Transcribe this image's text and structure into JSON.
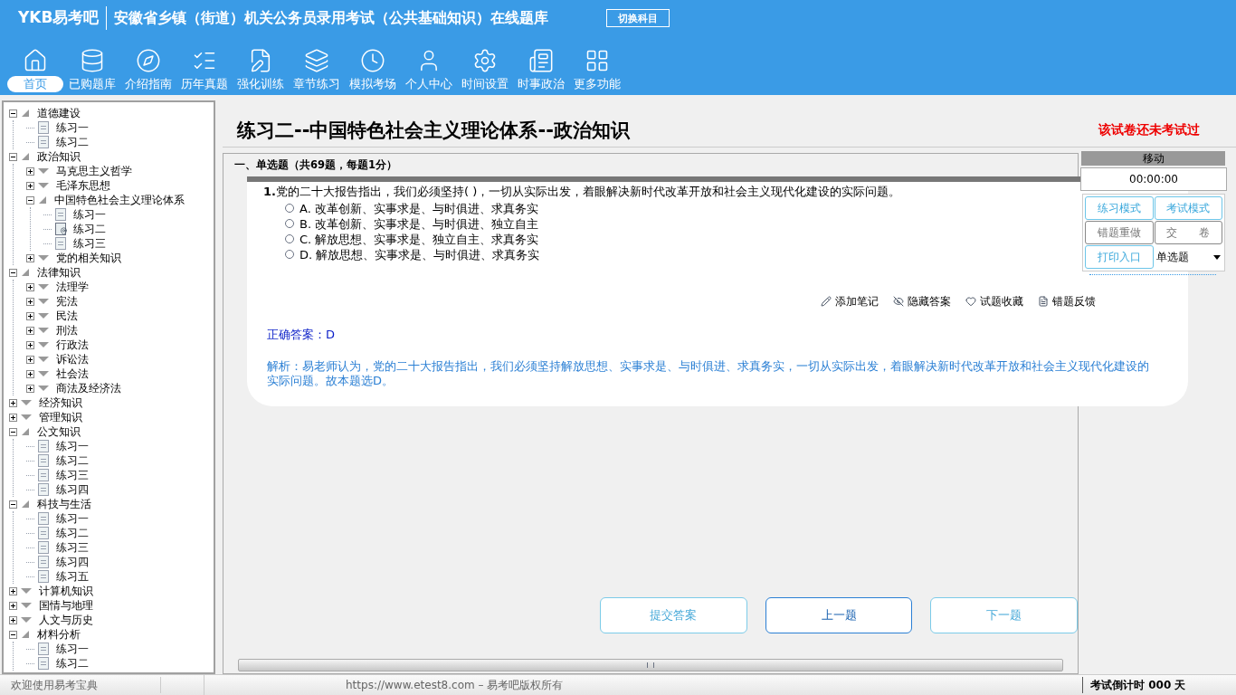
{
  "header": {
    "logo": "YKB易考吧",
    "title": "安徽省乡镇（街道）机关公务员录用考试（公共基础知识）在线题库",
    "switch_button": "切换科目"
  },
  "toolbar": [
    {
      "label": "首页",
      "selected": true
    },
    {
      "label": "已购题库",
      "selected": false
    },
    {
      "label": "介绍指南",
      "selected": false
    },
    {
      "label": "历年真题",
      "selected": false
    },
    {
      "label": "强化训练",
      "selected": false
    },
    {
      "label": "章节练习",
      "selected": false
    },
    {
      "label": "模拟考场",
      "selected": false
    },
    {
      "label": "个人中心",
      "selected": false
    },
    {
      "label": "时间设置",
      "selected": false
    },
    {
      "label": "时事政治",
      "selected": false
    },
    {
      "label": "更多功能",
      "selected": false
    }
  ],
  "tree": [
    {
      "label": "道德建设",
      "kind": "folder",
      "expanded": true,
      "children": [
        {
          "label": "练习一",
          "kind": "file",
          "selected": false
        },
        {
          "label": "练习二",
          "kind": "file",
          "selected": false
        }
      ]
    },
    {
      "label": "政治知识",
      "kind": "folder",
      "expanded": true,
      "children": [
        {
          "label": "马克思主义哲学",
          "kind": "folder",
          "expanded": false
        },
        {
          "label": "毛泽东思想",
          "kind": "folder",
          "expanded": false
        },
        {
          "label": "中国特色社会主义理论体系",
          "kind": "folder",
          "expanded": true,
          "children": [
            {
              "label": "练习一",
              "kind": "file",
              "selected": false
            },
            {
              "label": "练习二",
              "kind": "file",
              "selected": true
            },
            {
              "label": "练习三",
              "kind": "file",
              "selected": false
            }
          ]
        },
        {
          "label": "党的相关知识",
          "kind": "folder",
          "expanded": false
        }
      ]
    },
    {
      "label": "法律知识",
      "kind": "folder",
      "expanded": true,
      "children": [
        {
          "label": "法理学",
          "kind": "folder",
          "expanded": false
        },
        {
          "label": "宪法",
          "kind": "folder",
          "expanded": false
        },
        {
          "label": "民法",
          "kind": "folder",
          "expanded": false
        },
        {
          "label": "刑法",
          "kind": "folder",
          "expanded": false
        },
        {
          "label": "行政法",
          "kind": "folder",
          "expanded": false
        },
        {
          "label": "诉讼法",
          "kind": "folder",
          "expanded": false
        },
        {
          "label": "社会法",
          "kind": "folder",
          "expanded": false
        },
        {
          "label": "商法及经济法",
          "kind": "folder",
          "expanded": false
        }
      ]
    },
    {
      "label": "经济知识",
      "kind": "folder",
      "expanded": false
    },
    {
      "label": "管理知识",
      "kind": "folder",
      "expanded": false
    },
    {
      "label": "公文知识",
      "kind": "folder",
      "expanded": true,
      "children": [
        {
          "label": "练习一",
          "kind": "file",
          "selected": false
        },
        {
          "label": "练习二",
          "kind": "file",
          "selected": false
        },
        {
          "label": "练习三",
          "kind": "file",
          "selected": false
        },
        {
          "label": "练习四",
          "kind": "file",
          "selected": false
        }
      ]
    },
    {
      "label": "科技与生活",
      "kind": "folder",
      "expanded": true,
      "children": [
        {
          "label": "练习一",
          "kind": "file",
          "selected": false
        },
        {
          "label": "练习二",
          "kind": "file",
          "selected": false
        },
        {
          "label": "练习三",
          "kind": "file",
          "selected": false
        },
        {
          "label": "练习四",
          "kind": "file",
          "selected": false
        },
        {
          "label": "练习五",
          "kind": "file",
          "selected": false
        }
      ]
    },
    {
      "label": "计算机知识",
      "kind": "folder",
      "expanded": false
    },
    {
      "label": "国情与地理",
      "kind": "folder",
      "expanded": false
    },
    {
      "label": "人文与历史",
      "kind": "folder",
      "expanded": false
    },
    {
      "label": "材料分析",
      "kind": "folder",
      "expanded": true,
      "children": [
        {
          "label": "练习一",
          "kind": "file",
          "selected": false
        },
        {
          "label": "练习二",
          "kind": "file",
          "selected": false
        }
      ]
    }
  ],
  "paper": {
    "title": "练习二--中国特色社会主义理论体系--政治知识",
    "status": "该试卷还未考试过",
    "section": "一、单选题（共69题，每题1分）"
  },
  "question": {
    "number": "1.",
    "text": "党的二十大报告指出，我们必须坚持( )，一切从实际出发，着眼解决新时代改革开放和社会主义现代化建设的实际问题。",
    "options": [
      {
        "label": "A. 改革创新、实事求是、与时俱进、求真务实",
        "selected": false
      },
      {
        "label": "B. 改革创新、实事求是、与时俱进、独立自主",
        "selected": false
      },
      {
        "label": "C. 解放思想、实事求是、独立自主、求真务实",
        "selected": false
      },
      {
        "label": "D. 解放思想、实事求是、与时俱进、求真务实",
        "selected": false
      }
    ],
    "actions": [
      "添加笔记",
      "隐藏答案",
      "试题收藏",
      "错题反馈"
    ],
    "answer": "正确答案：D",
    "analysis": "解析：易老师认为，党的二十大报告指出，我们必须坚持解放思想、实事求是、与时俱进、求真务实，一切从实际出发，着眼解决新时代改革开放和社会主义现代化建设的实际问题。故本题选D。"
  },
  "nav_buttons": [
    {
      "label": "提交答案",
      "selected": false
    },
    {
      "label": "上一题",
      "selected": true
    },
    {
      "label": "下一题",
      "selected": false
    }
  ],
  "side_panel": {
    "header": "移动",
    "timer": "00:00:00",
    "buttons": [
      {
        "label": "练习模式",
        "disabled": false
      },
      {
        "label": "考试模式",
        "disabled": false
      },
      {
        "label": "错题重做",
        "disabled": true
      },
      {
        "label": "交　　卷",
        "disabled": true
      },
      {
        "label": "打印入口",
        "disabled": false
      }
    ],
    "type_select": "单选题"
  },
  "status_bar": {
    "welcome": "欢迎使用易考宝典",
    "copyright": "https://www.etest8.com – 易考吧版权所有",
    "countdown": "考试倒计时 000 天"
  }
}
